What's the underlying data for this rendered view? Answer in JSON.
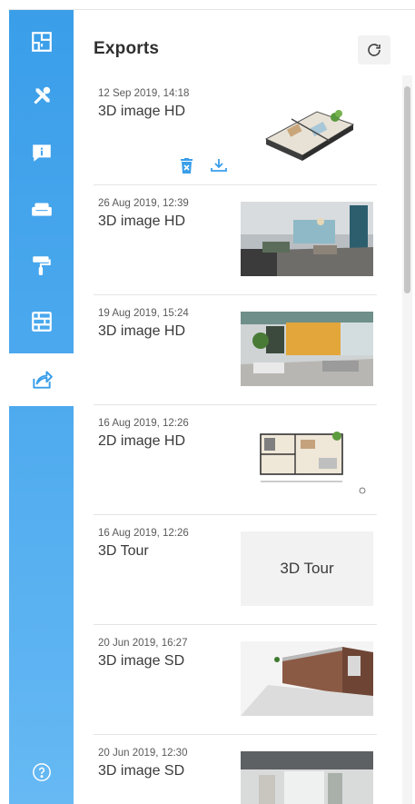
{
  "header": {
    "title": "Exports"
  },
  "sidebar": {
    "items": [
      {
        "icon": "floorplan-icon"
      },
      {
        "icon": "tools-icon"
      },
      {
        "icon": "info-icon"
      },
      {
        "icon": "sofa-icon"
      },
      {
        "icon": "paint-roller-icon"
      },
      {
        "icon": "brick-wall-icon"
      },
      {
        "icon": "export-icon",
        "active": true
      },
      {
        "icon": "help-icon"
      }
    ]
  },
  "exports": [
    {
      "date": "12 Sep 2019, 14:18",
      "name": "3D image HD",
      "thumb": "3d-floorplan"
    },
    {
      "date": "26 Aug 2019, 12:39",
      "name": "3D image HD",
      "thumb": "living-room-gray"
    },
    {
      "date": "19 Aug 2019, 15:24",
      "name": "3D image HD",
      "thumb": "living-room-yellow"
    },
    {
      "date": "16 Aug 2019, 12:26",
      "name": "2D image HD",
      "thumb": "2d-floorplan"
    },
    {
      "date": "16 Aug 2019, 12:26",
      "name": "3D Tour",
      "thumb_text": "3D Tour"
    },
    {
      "date": "20 Jun 2019, 16:27",
      "name": "3D image SD",
      "thumb": "brick-exterior"
    },
    {
      "date": "20 Jun 2019, 12:30",
      "name": "3D image SD",
      "thumb": "interior-room"
    }
  ],
  "colors": {
    "sidebar": "#3a9ee9",
    "accent": "#3a9ee9"
  }
}
